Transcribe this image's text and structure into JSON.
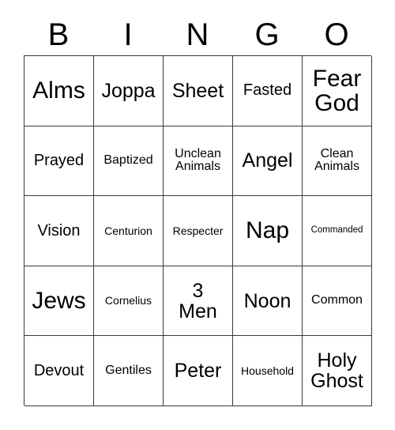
{
  "card": {
    "title_letters": [
      "B",
      "I",
      "N",
      "G",
      "O"
    ],
    "columns": 5,
    "rows": 5,
    "border_color": "#3a3a3a",
    "cell_background": "#ffffff",
    "text_color": "#000000",
    "cells": [
      [
        {
          "text": "Alms",
          "size": "fs-xl"
        },
        {
          "text": "Joppa",
          "size": "fs-lg"
        },
        {
          "text": "Sheet",
          "size": "fs-lg"
        },
        {
          "text": "Fasted",
          "size": "fs-md"
        },
        {
          "text": "Fear\nGod",
          "size": "fs-xl"
        }
      ],
      [
        {
          "text": "Prayed",
          "size": "fs-md"
        },
        {
          "text": "Baptized",
          "size": "fs-sm"
        },
        {
          "text": "Unclean\nAnimals",
          "size": "fs-sm"
        },
        {
          "text": "Angel",
          "size": "fs-lg"
        },
        {
          "text": "Clean\nAnimals",
          "size": "fs-sm"
        }
      ],
      [
        {
          "text": "Vision",
          "size": "fs-md"
        },
        {
          "text": "Centurion",
          "size": "fs-xs"
        },
        {
          "text": "Respecter",
          "size": "fs-xs"
        },
        {
          "text": "Nap",
          "size": "fs-xl"
        },
        {
          "text": "Commanded",
          "size": "fs-xxs"
        }
      ],
      [
        {
          "text": "Jews",
          "size": "fs-xl"
        },
        {
          "text": "Cornelius",
          "size": "fs-xs"
        },
        {
          "text": "3\nMen",
          "size": "fs-lg"
        },
        {
          "text": "Noon",
          "size": "fs-lg"
        },
        {
          "text": "Common",
          "size": "fs-sm"
        }
      ],
      [
        {
          "text": "Devout",
          "size": "fs-md"
        },
        {
          "text": "Gentiles",
          "size": "fs-sm"
        },
        {
          "text": "Peter",
          "size": "fs-lg"
        },
        {
          "text": "Household",
          "size": "fs-xs"
        },
        {
          "text": "Holy\nGhost",
          "size": "fs-lg"
        }
      ]
    ]
  }
}
